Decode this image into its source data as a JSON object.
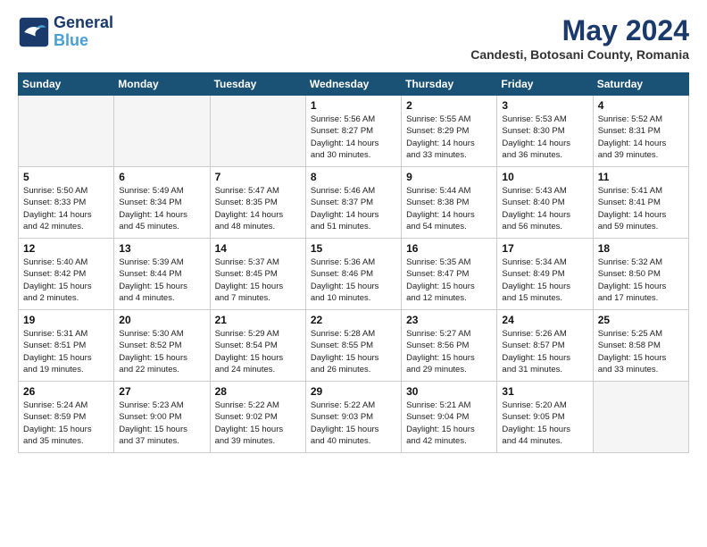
{
  "logo": {
    "line1": "General",
    "line2": "Blue"
  },
  "title": "May 2024",
  "subtitle": "Candesti, Botosani County, Romania",
  "days_of_week": [
    "Sunday",
    "Monday",
    "Tuesday",
    "Wednesday",
    "Thursday",
    "Friday",
    "Saturday"
  ],
  "weeks": [
    [
      {
        "day": "",
        "info": ""
      },
      {
        "day": "",
        "info": ""
      },
      {
        "day": "",
        "info": ""
      },
      {
        "day": "1",
        "info": "Sunrise: 5:56 AM\nSunset: 8:27 PM\nDaylight: 14 hours\nand 30 minutes."
      },
      {
        "day": "2",
        "info": "Sunrise: 5:55 AM\nSunset: 8:29 PM\nDaylight: 14 hours\nand 33 minutes."
      },
      {
        "day": "3",
        "info": "Sunrise: 5:53 AM\nSunset: 8:30 PM\nDaylight: 14 hours\nand 36 minutes."
      },
      {
        "day": "4",
        "info": "Sunrise: 5:52 AM\nSunset: 8:31 PM\nDaylight: 14 hours\nand 39 minutes."
      }
    ],
    [
      {
        "day": "5",
        "info": "Sunrise: 5:50 AM\nSunset: 8:33 PM\nDaylight: 14 hours\nand 42 minutes."
      },
      {
        "day": "6",
        "info": "Sunrise: 5:49 AM\nSunset: 8:34 PM\nDaylight: 14 hours\nand 45 minutes."
      },
      {
        "day": "7",
        "info": "Sunrise: 5:47 AM\nSunset: 8:35 PM\nDaylight: 14 hours\nand 48 minutes."
      },
      {
        "day": "8",
        "info": "Sunrise: 5:46 AM\nSunset: 8:37 PM\nDaylight: 14 hours\nand 51 minutes."
      },
      {
        "day": "9",
        "info": "Sunrise: 5:44 AM\nSunset: 8:38 PM\nDaylight: 14 hours\nand 54 minutes."
      },
      {
        "day": "10",
        "info": "Sunrise: 5:43 AM\nSunset: 8:40 PM\nDaylight: 14 hours\nand 56 minutes."
      },
      {
        "day": "11",
        "info": "Sunrise: 5:41 AM\nSunset: 8:41 PM\nDaylight: 14 hours\nand 59 minutes."
      }
    ],
    [
      {
        "day": "12",
        "info": "Sunrise: 5:40 AM\nSunset: 8:42 PM\nDaylight: 15 hours\nand 2 minutes."
      },
      {
        "day": "13",
        "info": "Sunrise: 5:39 AM\nSunset: 8:44 PM\nDaylight: 15 hours\nand 4 minutes."
      },
      {
        "day": "14",
        "info": "Sunrise: 5:37 AM\nSunset: 8:45 PM\nDaylight: 15 hours\nand 7 minutes."
      },
      {
        "day": "15",
        "info": "Sunrise: 5:36 AM\nSunset: 8:46 PM\nDaylight: 15 hours\nand 10 minutes."
      },
      {
        "day": "16",
        "info": "Sunrise: 5:35 AM\nSunset: 8:47 PM\nDaylight: 15 hours\nand 12 minutes."
      },
      {
        "day": "17",
        "info": "Sunrise: 5:34 AM\nSunset: 8:49 PM\nDaylight: 15 hours\nand 15 minutes."
      },
      {
        "day": "18",
        "info": "Sunrise: 5:32 AM\nSunset: 8:50 PM\nDaylight: 15 hours\nand 17 minutes."
      }
    ],
    [
      {
        "day": "19",
        "info": "Sunrise: 5:31 AM\nSunset: 8:51 PM\nDaylight: 15 hours\nand 19 minutes."
      },
      {
        "day": "20",
        "info": "Sunrise: 5:30 AM\nSunset: 8:52 PM\nDaylight: 15 hours\nand 22 minutes."
      },
      {
        "day": "21",
        "info": "Sunrise: 5:29 AM\nSunset: 8:54 PM\nDaylight: 15 hours\nand 24 minutes."
      },
      {
        "day": "22",
        "info": "Sunrise: 5:28 AM\nSunset: 8:55 PM\nDaylight: 15 hours\nand 26 minutes."
      },
      {
        "day": "23",
        "info": "Sunrise: 5:27 AM\nSunset: 8:56 PM\nDaylight: 15 hours\nand 29 minutes."
      },
      {
        "day": "24",
        "info": "Sunrise: 5:26 AM\nSunset: 8:57 PM\nDaylight: 15 hours\nand 31 minutes."
      },
      {
        "day": "25",
        "info": "Sunrise: 5:25 AM\nSunset: 8:58 PM\nDaylight: 15 hours\nand 33 minutes."
      }
    ],
    [
      {
        "day": "26",
        "info": "Sunrise: 5:24 AM\nSunset: 8:59 PM\nDaylight: 15 hours\nand 35 minutes."
      },
      {
        "day": "27",
        "info": "Sunrise: 5:23 AM\nSunset: 9:00 PM\nDaylight: 15 hours\nand 37 minutes."
      },
      {
        "day": "28",
        "info": "Sunrise: 5:22 AM\nSunset: 9:02 PM\nDaylight: 15 hours\nand 39 minutes."
      },
      {
        "day": "29",
        "info": "Sunrise: 5:22 AM\nSunset: 9:03 PM\nDaylight: 15 hours\nand 40 minutes."
      },
      {
        "day": "30",
        "info": "Sunrise: 5:21 AM\nSunset: 9:04 PM\nDaylight: 15 hours\nand 42 minutes."
      },
      {
        "day": "31",
        "info": "Sunrise: 5:20 AM\nSunset: 9:05 PM\nDaylight: 15 hours\nand 44 minutes."
      },
      {
        "day": "",
        "info": ""
      }
    ]
  ]
}
